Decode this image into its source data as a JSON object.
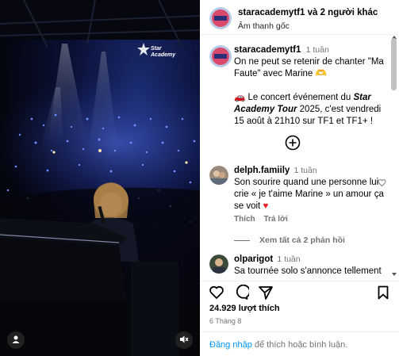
{
  "header": {
    "username": "staracademytf1",
    "collab": "và 2 người khác",
    "audio": "Âm thanh gốc"
  },
  "caption": {
    "username": "staracademytf1",
    "time": "1 tuần",
    "line1": "On ne peut se retenir de chanter \"Ma Faute\" avec Marine 🫶",
    "emoji": "🚗",
    "line2_prefix": " Le concert événement du ",
    "line2_bold": "Star Academy Tour",
    "line2_suffix": " 2025, c'est vendredi 15 août à 21h10 sur TF1 et TF1+ !"
  },
  "comments": [
    {
      "username": "delph.famiily",
      "time": "1 tuần",
      "text": "Son sourire quand une personne lui crie « je t'aime Marine » un amour ça se voit",
      "emoji": "♥",
      "likes_label": "Thích",
      "reply_label": "Trả lời",
      "view_replies": "Xem tất cả 2 phản hồi"
    },
    {
      "username": "olparigot",
      "time": "1 tuần",
      "text": "Sa tournée solo s'annonce tellement"
    }
  ],
  "footer": {
    "likes": "24.929 lượt thích",
    "date": "6 Tháng 8",
    "login_link": "Đăng nhập",
    "login_rest": " để thích hoặc bình luận."
  },
  "media": {
    "watermark": "Star Academy"
  },
  "colors": {
    "link": "#0095f6",
    "muted": "#737373",
    "heart": "#ed1c24"
  }
}
